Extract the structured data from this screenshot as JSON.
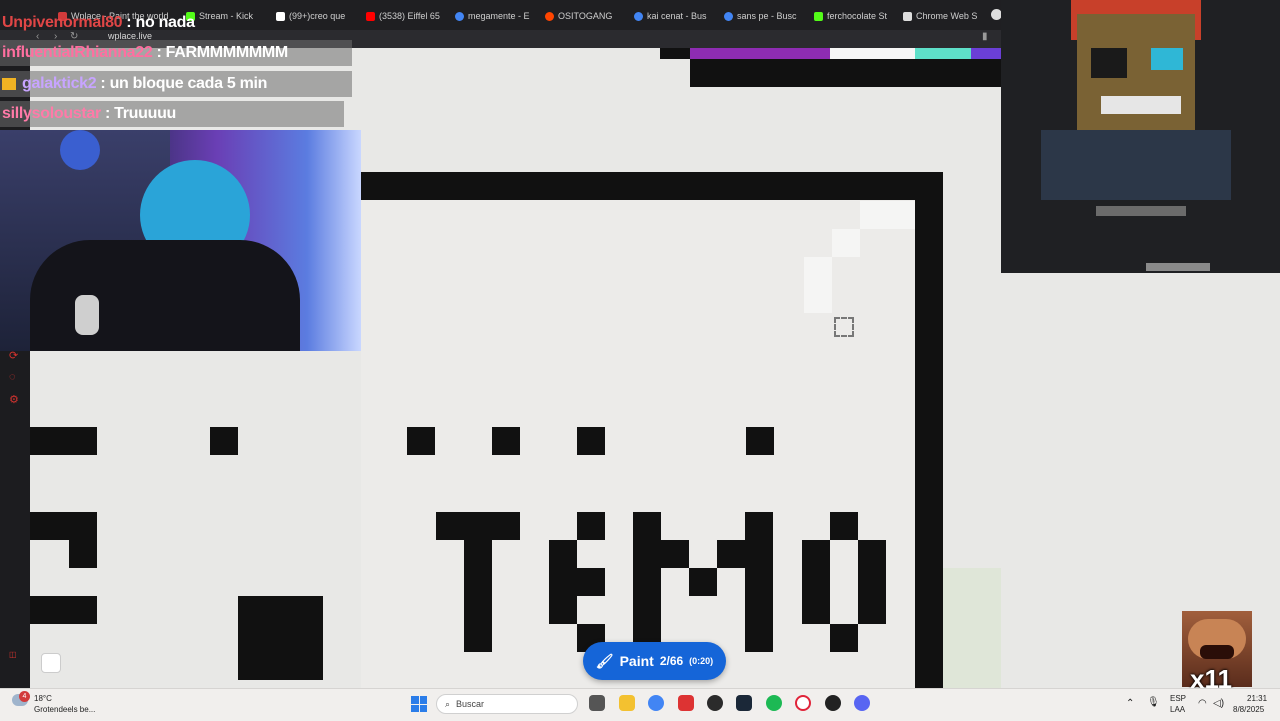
{
  "browser": {
    "tabs": [
      {
        "label": "Wplace - Paint the world",
        "color": "#d23b3b"
      },
      {
        "label": "Stream - Kick",
        "color": "#53fc18"
      },
      {
        "label": "(99+)creo que",
        "color": "#ffffff"
      },
      {
        "label": "(3538) Eiffel 65",
        "color": "#ff0000"
      },
      {
        "label": "megamente - E",
        "color": "#4285f4"
      },
      {
        "label": "OSITOGANG",
        "color": "#ff4500"
      },
      {
        "label": "kai cenat - Bus",
        "color": "#4285f4"
      },
      {
        "label": "sans pe - Busc",
        "color": "#4285f4"
      },
      {
        "label": "ferchocolate St",
        "color": "#53fc18"
      },
      {
        "label": "Chrome Web S",
        "color": "#dddddd"
      }
    ],
    "url": "wplace.live"
  },
  "chat": {
    "messages": [
      {
        "user": "Unpivenormal80",
        "text": ": no nada",
        "user_color": "#e04646"
      },
      {
        "user": "influentialRhianna22",
        "text": ": FARMMMMMMM",
        "user_color": "#ff6fa0"
      },
      {
        "user": "galaktick2",
        "text": ": un bloque cada 5 min",
        "user_color": "#c7a4ff"
      },
      {
        "user": "sillysoloustar",
        "text": ": Truuuuu",
        "user_color": "#ff7aa8"
      }
    ]
  },
  "paint": {
    "label": "Paint",
    "count": "2/66",
    "timer": "(0:20)"
  },
  "taskbar": {
    "weather_temp": "18°C",
    "weather_desc": "Grotendeels be...",
    "search_placeholder": "Buscar",
    "lang_top": "ESP",
    "lang_bottom": "LAA",
    "time": "21:31",
    "date": "8/8/2025",
    "notification_badge": "4"
  },
  "emote": {
    "multiplier": "x11"
  },
  "colors": {
    "accent": "#1565d8",
    "pixel": "#111111",
    "canvas_bg": "#e8e8e6"
  }
}
